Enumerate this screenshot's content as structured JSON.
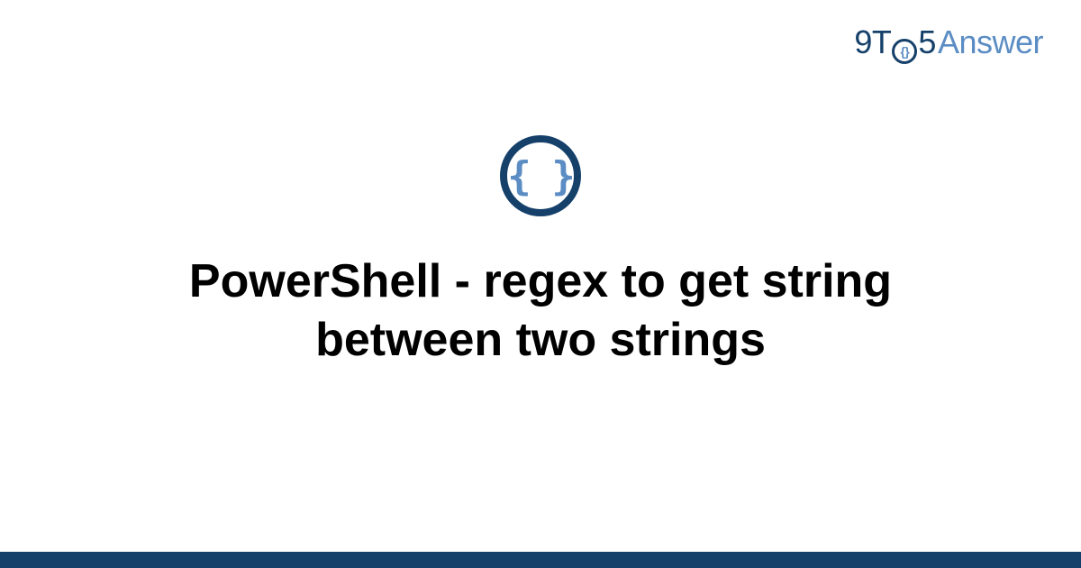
{
  "logo": {
    "part_nine": "9",
    "part_t": "T",
    "circle_inner": "{}",
    "part_five": "5",
    "part_answer": "Answer"
  },
  "icon": {
    "glyph": "{ }"
  },
  "title": "PowerShell - regex to get string between two strings",
  "colors": {
    "primary_dark": "#15406a",
    "primary_light": "#5b8dc4"
  }
}
